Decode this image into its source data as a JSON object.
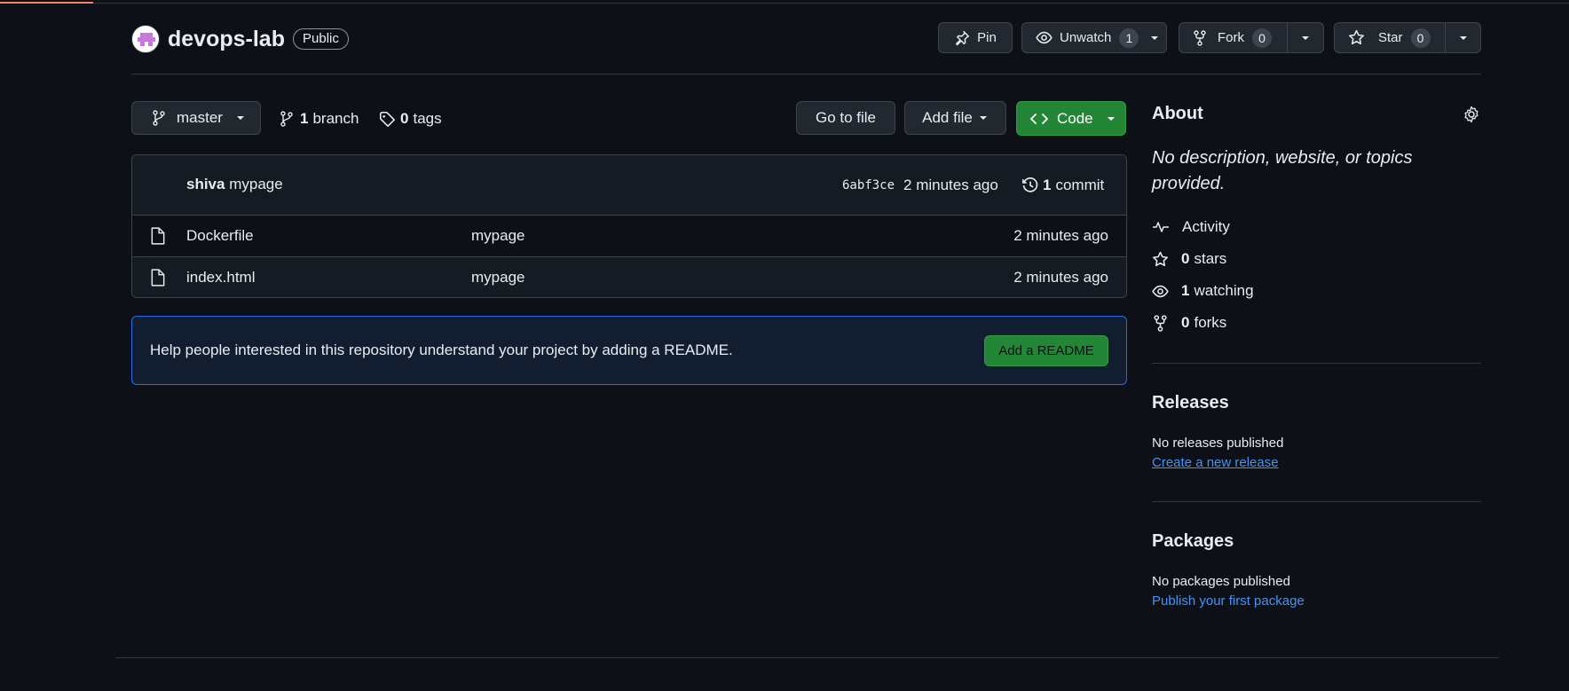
{
  "repo": {
    "name": "devops-lab",
    "visibility": "Public"
  },
  "actions": {
    "pin": "Pin",
    "unwatch": "Unwatch",
    "watch_count": "1",
    "fork": "Fork",
    "fork_count": "0",
    "star": "Star",
    "star_count": "0"
  },
  "toolbar": {
    "branch": "master",
    "branch_count": "1",
    "branch_label": "branch",
    "tag_count": "0",
    "tag_label": "tags",
    "go_to_file": "Go to file",
    "add_file": "Add file",
    "code": "Code"
  },
  "latest_commit": {
    "author": "shiva",
    "message": "mypage",
    "sha": "6abf3ce",
    "time": "2 minutes ago",
    "commit_count": "1",
    "commit_label": "commit"
  },
  "files": [
    {
      "name": "Dockerfile",
      "message": "mypage",
      "time": "2 minutes ago"
    },
    {
      "name": "index.html",
      "message": "mypage",
      "time": "2 minutes ago"
    }
  ],
  "readme_prompt": {
    "text": "Help people interested in this repository understand your project by adding a README.",
    "button": "Add a README"
  },
  "about": {
    "title": "About",
    "description": "No description, website, or topics provided.",
    "activity": "Activity",
    "stars_count": "0",
    "stars_label": "stars",
    "watching_count": "1",
    "watching_label": "watching",
    "forks_count": "0",
    "forks_label": "forks"
  },
  "releases": {
    "title": "Releases",
    "empty": "No releases published",
    "link": "Create a new release"
  },
  "packages": {
    "title": "Packages",
    "empty": "No packages published",
    "link": "Publish your first package"
  },
  "colors": {
    "background": "#0d1117",
    "border": "#30363d",
    "accent_green": "#238636",
    "link_blue": "#4493f8"
  }
}
